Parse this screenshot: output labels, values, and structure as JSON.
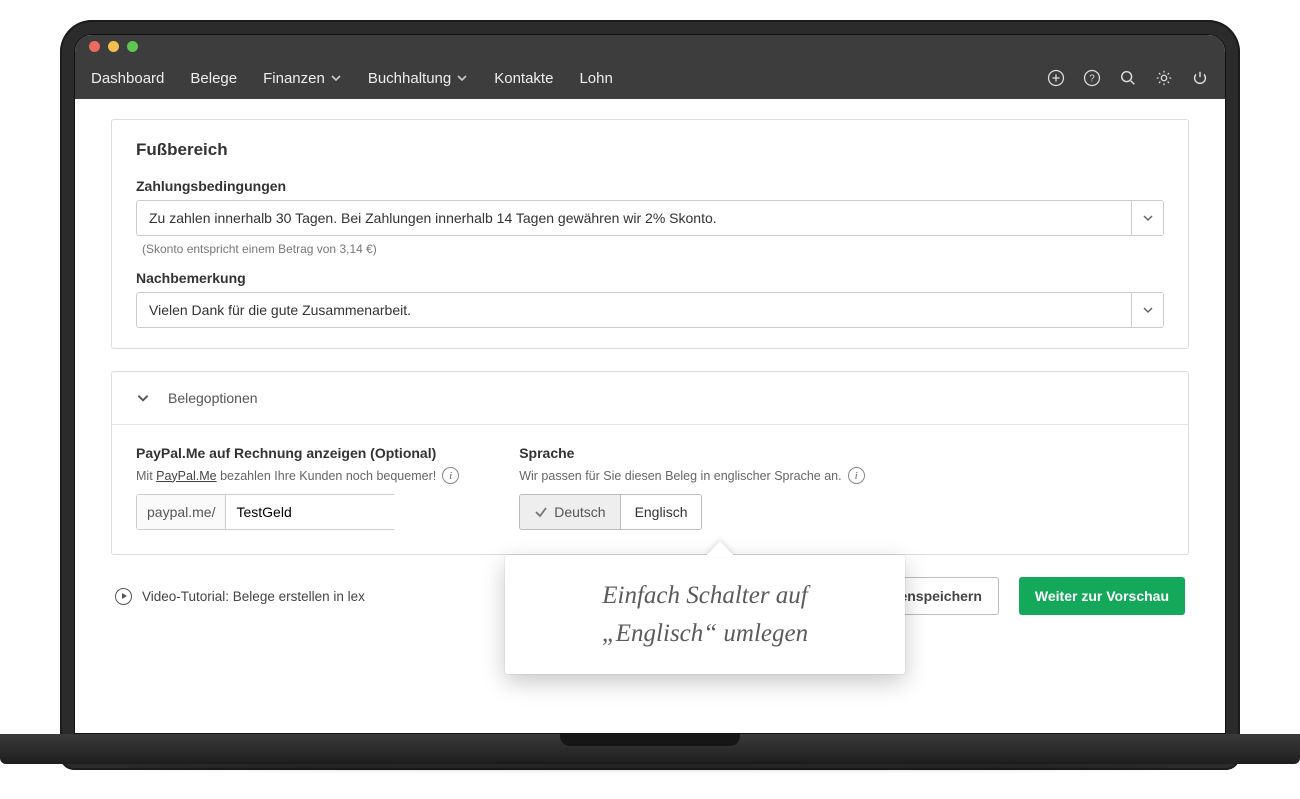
{
  "nav": {
    "dashboard": "Dashboard",
    "belege": "Belege",
    "finanzen": "Finanzen",
    "buchhaltung": "Buchhaltung",
    "kontakte": "Kontakte",
    "lohn": "Lohn"
  },
  "footer_section": {
    "title": "Fußbereich",
    "payment_terms_label": "Zahlungsbedingungen",
    "payment_terms_value": "Zu zahlen innerhalb 30 Tagen. Bei Zahlungen innerhalb 14 Tagen gewähren wir 2% Skonto.",
    "skonto_hint": "(Skonto entspricht einem Betrag von 3,14 €)",
    "postscript_label": "Nachbemerkung",
    "postscript_value": "Vielen Dank für die gute Zusammenarbeit."
  },
  "options": {
    "header": "Belegoptionen",
    "paypal": {
      "title": "PayPal.Me auf Rechnung anzeigen (Optional)",
      "subtitle_prefix": "Mit ",
      "subtitle_link": "PayPal.Me",
      "subtitle_suffix": " bezahlen Ihre Kunden noch bequemer!",
      "prefix": "paypal.me/",
      "value": "TestGeld"
    },
    "language": {
      "title": "Sprache",
      "subtitle": "Wir passen für Sie diesen Beleg in englischer Sprache an.",
      "german": "Deutsch",
      "english": "Englisch"
    }
  },
  "footer_row": {
    "tutorial_text": "Video-Tutorial: Belege erstellen in lex",
    "save_draft": "Zwischenspeichern",
    "preview": "Weiter zur Vorschau"
  },
  "callout": {
    "line1": "Einfach Schalter auf",
    "line2": "„Englisch“ umlegen"
  }
}
